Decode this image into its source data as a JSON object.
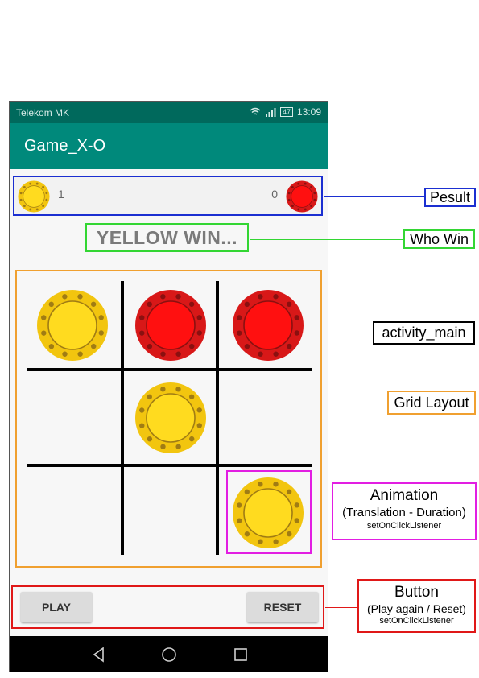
{
  "status_bar": {
    "carrier": "Telekom MK",
    "battery": "47",
    "time": "13:09"
  },
  "app_bar": {
    "title": "Game_X-O"
  },
  "score": {
    "yellow": "1",
    "red": "0"
  },
  "result_text": "YELLOW WIN...",
  "board": [
    [
      "yellow",
      "red",
      "red"
    ],
    [
      "",
      "yellow",
      ""
    ],
    [
      "",
      "",
      "yellow"
    ]
  ],
  "buttons": {
    "play": "PLAY",
    "reset": "RESET"
  },
  "annotations": {
    "result": "Pesult",
    "who_win": "Who Win",
    "activity": "activity_main",
    "grid": "Grid Layout",
    "animation": {
      "title": "Animation",
      "sub": "(Translation - Duration)",
      "method": "setOnClickListener"
    },
    "button": {
      "title": "Button",
      "sub": "(Play again / Reset)",
      "method": "setOnClickListener"
    }
  },
  "colors": {
    "yellow_outer": "#f2c50f",
    "yellow_inner": "#ffdb1f",
    "yellow_dot": "#a07c14",
    "red_outer": "#d81818",
    "red_inner": "#ff1010",
    "red_dot": "#8a1010",
    "appbar": "#00897b",
    "statusbar": "#00695c"
  },
  "icons": [
    "wifi-icon",
    "signal-icon",
    "battery-icon",
    "back-icon",
    "home-icon",
    "recents-icon"
  ]
}
